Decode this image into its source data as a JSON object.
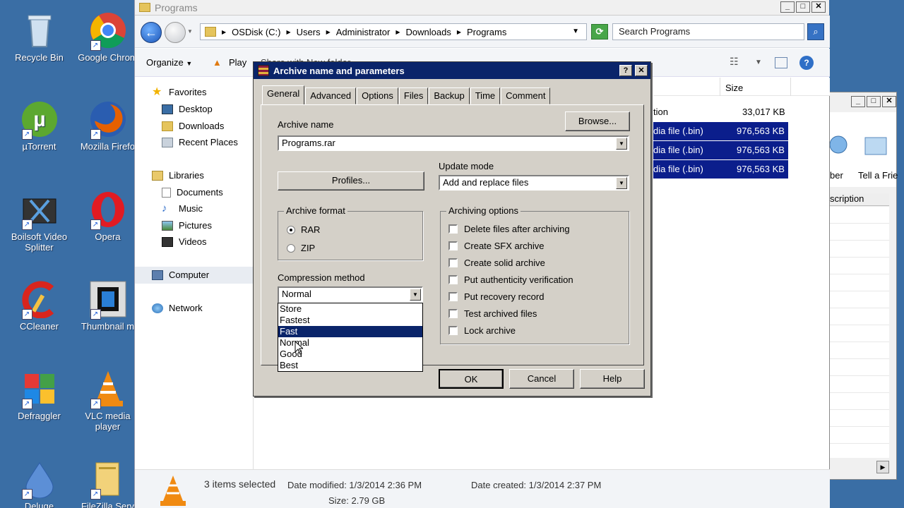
{
  "desktop": {
    "icons": [
      {
        "label": "Recycle Bin",
        "icon": "recycle-bin-icon"
      },
      {
        "label": "Google Chrom",
        "icon": "chrome-icon"
      },
      {
        "label": "µTorrent",
        "icon": "utorrent-icon"
      },
      {
        "label": "Mozilla Firefo",
        "icon": "firefox-icon"
      },
      {
        "label": "Boilsoft Video Splitter",
        "icon": "video-splitter-icon"
      },
      {
        "label": "Opera",
        "icon": "opera-icon"
      },
      {
        "label": "CCleaner",
        "icon": "ccleaner-icon"
      },
      {
        "label": "Thumbnail m",
        "icon": "thumbnail-icon"
      },
      {
        "label": "Defraggler",
        "icon": "defraggler-icon"
      },
      {
        "label": "VLC media player",
        "icon": "vlc-icon"
      },
      {
        "label": "Deluge",
        "icon": "deluge-icon"
      },
      {
        "label": "FileZilla Serv",
        "icon": "filezilla-icon"
      }
    ]
  },
  "explorer": {
    "title": "Programs",
    "breadcrumb": [
      "OSDisk (C:)",
      "Users",
      "Administrator",
      "Downloads",
      "Programs"
    ],
    "search_placeholder": "Search Programs",
    "toolbar": {
      "organize": "Organize",
      "play": "Play",
      "hidden_text": "Share with   New folder"
    },
    "nav": {
      "favorites": "Favorites",
      "desktop": "Desktop",
      "downloads": "Downloads",
      "recent": "Recent Places",
      "libraries": "Libraries",
      "documents": "Documents",
      "music": "Music",
      "pictures": "Pictures",
      "videos": "Videos",
      "computer": "Computer",
      "network": "Network"
    },
    "columns": {
      "size": "Size"
    },
    "files": [
      {
        "type": "tion",
        "size": "33,017 KB",
        "selected": false
      },
      {
        "type": "dia file (.bin)",
        "size": "976,563 KB",
        "selected": true
      },
      {
        "type": "dia file (.bin)",
        "size": "976,563 KB",
        "selected": true
      },
      {
        "type": "dia file (.bin)",
        "size": "976,563 KB",
        "selected": true
      }
    ],
    "status": {
      "items_selected": "3 items selected",
      "date_modified": "Date modified: 1/3/2014 2:36 PM",
      "date_created": "Date created: 1/3/2014 2:37 PM",
      "size": "Size: 2.79 GB"
    }
  },
  "right_window": {
    "labels": [
      "ber",
      "Tell a Frie",
      "scription"
    ]
  },
  "dialog": {
    "title": "Archive name and parameters",
    "tabs": [
      "General",
      "Advanced",
      "Options",
      "Files",
      "Backup",
      "Time",
      "Comment"
    ],
    "archive_name_label": "Archive name",
    "browse_label": "Browse...",
    "archive_name_value": "Programs.rar",
    "profiles_label": "Profiles...",
    "update_mode_label": "Update mode",
    "update_mode_value": "Add and replace files",
    "archive_format_label": "Archive format",
    "formats": [
      {
        "label": "RAR",
        "checked": true
      },
      {
        "label": "ZIP",
        "checked": false
      }
    ],
    "compression_label": "Compression method",
    "compression_value": "Normal",
    "compression_options": [
      "Store",
      "Fastest",
      "Fast",
      "Normal",
      "Good",
      "Best"
    ],
    "compression_highlighted": "Fast",
    "archiving_options_label": "Archiving options",
    "options": [
      {
        "label": "Delete files after archiving",
        "checked": false
      },
      {
        "label": "Create SFX archive",
        "checked": false
      },
      {
        "label": "Create solid archive",
        "checked": false
      },
      {
        "label": "Put authenticity verification",
        "checked": false
      },
      {
        "label": "Put recovery record",
        "checked": false
      },
      {
        "label": "Test archived files",
        "checked": false
      },
      {
        "label": "Lock archive",
        "checked": false
      }
    ],
    "ok": "OK",
    "cancel": "Cancel",
    "help": "Help"
  }
}
